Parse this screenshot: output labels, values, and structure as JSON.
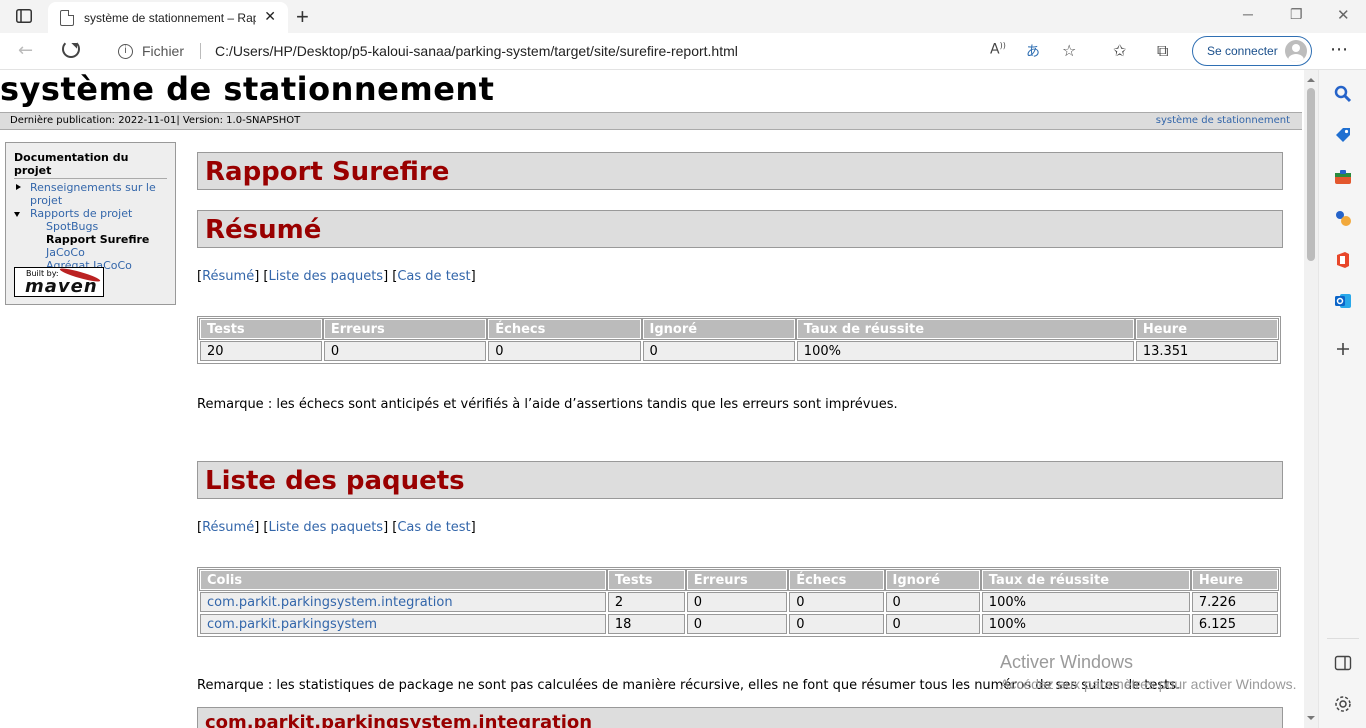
{
  "browser": {
    "tab_title": "système de stationnement – Rapport Surefire",
    "address_scheme": "Fichier",
    "url": "C:/Users/HP/Desktop/p5-kaloui-sanaa/parking-system/target/site/surefire-report.html",
    "signin_label": "Se connecter"
  },
  "page": {
    "site_title": "système de stationnement",
    "publication": "Dernière publication: 2022-11-01| Version: 1.0-SNAPSHOT",
    "breadcrumb_right": "système de stationnement"
  },
  "leftnav": {
    "heading": "Documentation du projet",
    "item_info_line1": "Renseignements sur le",
    "item_info_line2": "projet",
    "item_reports": "Rapports de projet",
    "sub_spotbugs": "SpotBugs",
    "sub_surefire": "Rapport Surefire",
    "sub_jacoco": "JaCoCo",
    "sub_jacoco_agg": "Agrégat JaCoCo",
    "built_by": "Built by:",
    "maven": "maven"
  },
  "main": {
    "report_title": "Rapport Surefire",
    "summary_title": "Résumé",
    "link_summary": "Résumé",
    "link_packages": "Liste des paquets",
    "link_tests": "Cas de test",
    "summary_table": {
      "headers": [
        "Tests",
        "Erreurs",
        "Échecs",
        "Ignoré",
        "Taux de réussite",
        "Heure"
      ],
      "row": [
        "20",
        "0",
        "0",
        "0",
        "100%",
        "13.351"
      ]
    },
    "summary_note": "Remarque : les échecs sont anticipés et vérifiés à l’aide d’assertions tandis que les erreurs sont imprévues.",
    "packages_title": "Liste des paquets",
    "packages_table": {
      "headers": [
        "Colis",
        "Tests",
        "Erreurs",
        "Échecs",
        "Ignoré",
        "Taux de réussite",
        "Heure"
      ],
      "rows": [
        [
          "com.parkit.parkingsystem.integration",
          "2",
          "0",
          "0",
          "0",
          "100%",
          "7.226"
        ],
        [
          "com.parkit.parkingsystem",
          "18",
          "0",
          "0",
          "0",
          "100%",
          "6.125"
        ]
      ]
    },
    "packages_note": "Remarque : les statistiques de package ne sont pas calculées de manière récursive, elles ne font que résumer tous les numéros de ses suites de tests.",
    "next_section": "com.parkit.parkingsystem.integration"
  },
  "watermark": {
    "line1": "Activer Windows",
    "line2": "Accédez aux paramètres pour activer Windows."
  }
}
